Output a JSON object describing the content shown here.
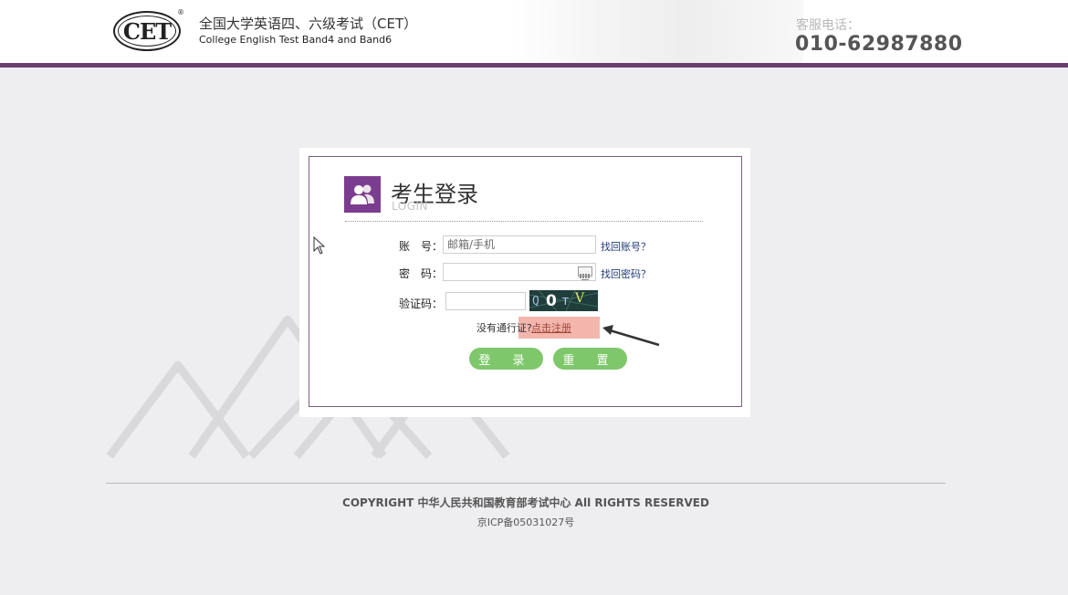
{
  "header": {
    "logo_text": "CET",
    "logo_reg": "®",
    "title_cn": "全国大学英语四、六级考试（CET）",
    "title_en": "College English Test Band4 and Band6",
    "service_label": "客服电话：",
    "service_phone": "010-62987880"
  },
  "login": {
    "title": "考生登录",
    "subtitle": "LOGIN",
    "account_label": "账　号：",
    "account_placeholder": "邮箱/手机",
    "forgot_account": "找回账号？",
    "password_label": "密　码：",
    "password_value": "",
    "forgot_password": "找回密码？",
    "captcha_label": "验证码：",
    "captcha_value": "",
    "captcha_text": "Q0TV",
    "no_pass_text": "没有通行证?",
    "register_link": "点击注册",
    "login_button": "登 录",
    "reset_button": "重 置"
  },
  "footer": {
    "copyright": "COPYRIGHT 中华人民共和国教育部考试中心 All RIGHTS RESERVED",
    "icp": "京ICP备05031027号"
  },
  "colors": {
    "header_bar": "#6a3f6e",
    "login_icon_bg": "#7b3d8f",
    "button_green": "#7ec86b",
    "register_highlight": "#f3b6ac",
    "link_blue": "#223a7a"
  },
  "icons": {
    "login_icon": "users-icon",
    "keyboard_icon": "keyboard-icon",
    "cursor": "mouse-pointer-icon",
    "annotation": "arrow-pointer-icon"
  }
}
